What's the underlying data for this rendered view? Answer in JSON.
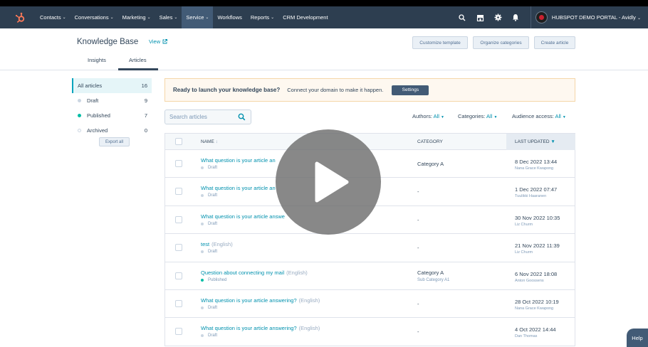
{
  "nav": {
    "items": [
      {
        "label": "Contacts",
        "caret": true
      },
      {
        "label": "Conversations",
        "caret": true
      },
      {
        "label": "Marketing",
        "caret": true
      },
      {
        "label": "Sales",
        "caret": true
      },
      {
        "label": "Service",
        "caret": true
      },
      {
        "label": "Workflows",
        "caret": false
      },
      {
        "label": "Reports",
        "caret": true
      },
      {
        "label": "CRM Development",
        "caret": false
      }
    ],
    "active_index": 4,
    "portal": "HUBSPOT DEMO PORTAL - Avidly",
    "brand_color": "#ff7a59",
    "bar_color": "#2d3e50"
  },
  "header": {
    "title": "Knowledge Base",
    "view_label": "View",
    "buttons": {
      "customize": "Customize template",
      "organize": "Organize categories",
      "create": "Create article"
    },
    "tabs": {
      "insights": "Insights",
      "articles": "Articles"
    }
  },
  "sidebar": {
    "items": [
      {
        "label": "All articles",
        "count": "16"
      },
      {
        "label": "Draft",
        "count": "9"
      },
      {
        "label": "Published",
        "count": "7"
      },
      {
        "label": "Archived",
        "count": "0"
      }
    ],
    "export_label": "Export all"
  },
  "banner": {
    "title": "Ready to launch your knowledge base?",
    "text": "Connect your domain to make it happen.",
    "button": "Settings"
  },
  "search": {
    "placeholder": "Search articles"
  },
  "filters": {
    "authors": {
      "label": "Authors:",
      "value": "All"
    },
    "categories": {
      "label": "Categories:",
      "value": "All"
    },
    "audience": {
      "label": "Audience access:",
      "value": "All"
    }
  },
  "table": {
    "headers": {
      "name": "NAME",
      "category": "CATEGORY",
      "updated": "LAST UPDATED"
    },
    "rows": [
      {
        "title": "What question is your article an",
        "lang": "",
        "status": "Draft",
        "category": "Category A",
        "subcategory": "",
        "date": "8 Dec 2022 13:44",
        "author": "Nana Grace Kwapong"
      },
      {
        "title": "What question is your article an",
        "lang": "",
        "status": "Draft",
        "category": "-",
        "subcategory": "",
        "date": "1 Dec 2022 07:47",
        "author": "Tuulikki Haaranen"
      },
      {
        "title": "What question is your article answe",
        "lang": "",
        "status": "Draft",
        "category": "-",
        "subcategory": "",
        "date": "30 Nov 2022 10:35",
        "author": "Liz Churm"
      },
      {
        "title": "test",
        "lang": "(English)",
        "status": "Draft",
        "category": "-",
        "subcategory": "",
        "date": "21 Nov 2022 11:39",
        "author": "Liz Churm"
      },
      {
        "title": "Question about connecting my mail",
        "lang": "(English)",
        "status": "Published",
        "category": "Category A",
        "subcategory": "Sub Category A1",
        "date": "6 Nov 2022 18:08",
        "author": "Anton Goossens"
      },
      {
        "title": "What question is your article answering?",
        "lang": "(English)",
        "status": "Draft",
        "category": "-",
        "subcategory": "",
        "date": "28 Oct 2022 10:19",
        "author": "Nana Grace Kwapong"
      },
      {
        "title": "What question is your article answering?",
        "lang": "(English)",
        "status": "Draft",
        "category": "-",
        "subcategory": "",
        "date": "4 Oct 2022 14:44",
        "author": "Dan Thomas"
      }
    ]
  },
  "status_colors": {
    "Draft": "#cbd6e2",
    "Published": "#00bda5",
    "Archived": "#ffffff"
  },
  "help_label": "Help"
}
